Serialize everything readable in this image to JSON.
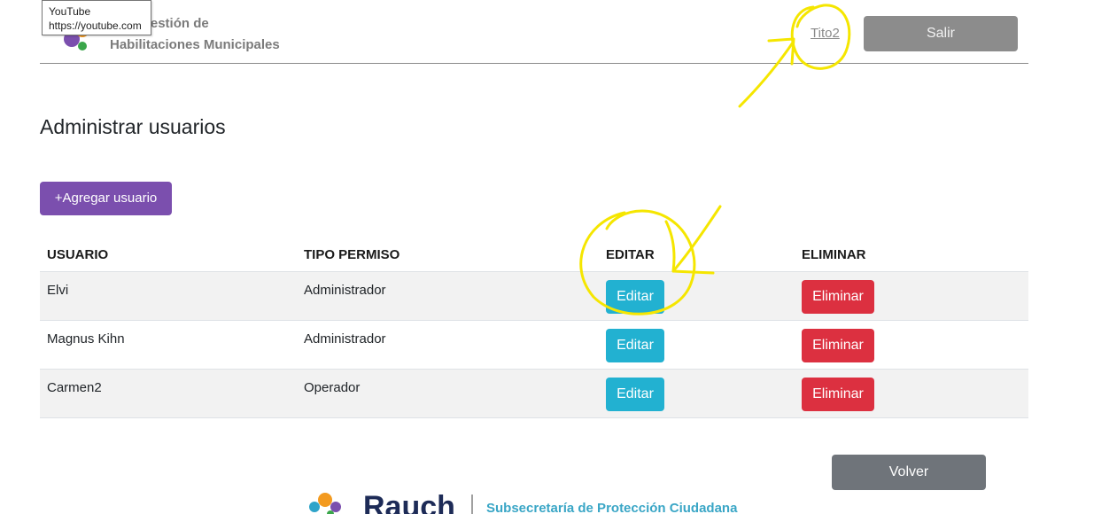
{
  "tooltip": {
    "title": "YouTube",
    "url": "https://youtube.com"
  },
  "header": {
    "title_line1": "a de Gestión de",
    "title_line2": "Habilitaciones Municipales",
    "user": "Tito2",
    "logout": "Salir"
  },
  "page": {
    "title": "Administrar usuarios",
    "add_button": "+Agregar usuario"
  },
  "table": {
    "headers": {
      "user": "USUARIO",
      "perm": "TIPO PERMISO",
      "edit": "EDITAR",
      "delete": "ELIMINAR"
    },
    "rows": [
      {
        "user": "Elvi",
        "perm": "Administrador",
        "edit": "Editar",
        "delete": "Eliminar"
      },
      {
        "user": "Magnus Kihn",
        "perm": "Administrador",
        "edit": "Editar",
        "delete": "Eliminar"
      },
      {
        "user": "Carmen2",
        "perm": "Operador",
        "edit": "Editar",
        "delete": "Eliminar"
      }
    ]
  },
  "back_button": "Volver",
  "footer": {
    "brand": "Rauch",
    "subtitle": "Subsecretaría de Protección Ciudadana"
  },
  "colors": {
    "add": "#7b4fae",
    "edit": "#22b1d1",
    "delete": "#dc3040",
    "annotation": "#f5e600"
  }
}
